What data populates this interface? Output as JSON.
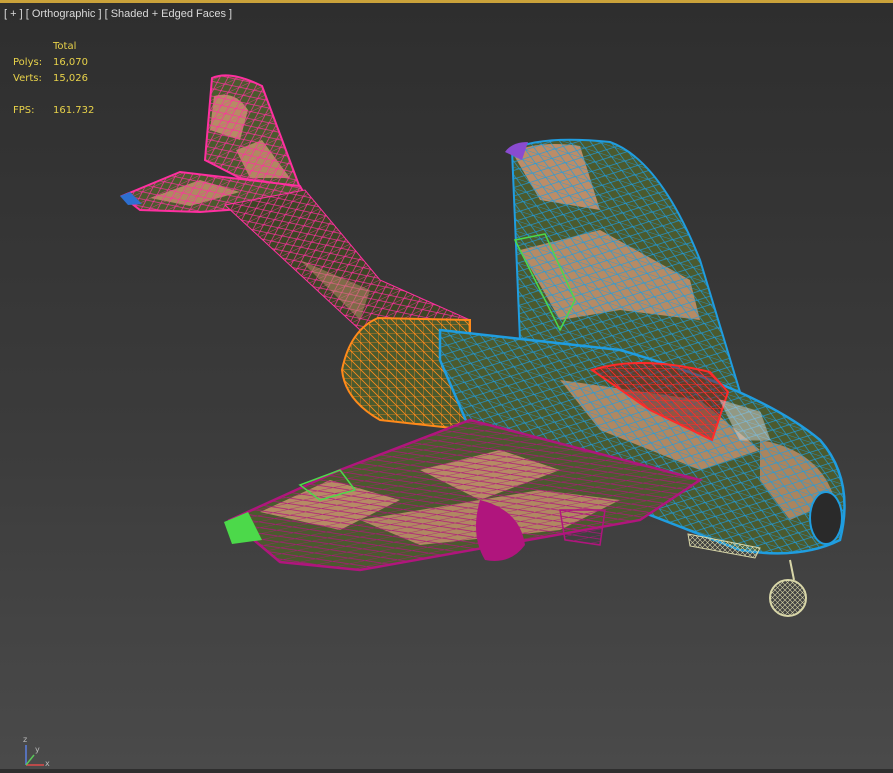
{
  "viewport": {
    "menu_plus": "[ + ]",
    "view_mode": "[ Orthographic ]",
    "shading_mode": "[ Shaded + Edged Faces ]",
    "accent_color": "#caa23a"
  },
  "stats": {
    "header": "Total",
    "polys_label": "Polys:",
    "polys_value": "16,070",
    "verts_label": "Verts:",
    "verts_value": "15,026",
    "fps_label": "FPS:",
    "fps_value": "161.732",
    "text_color": "#e8d24a"
  },
  "model": {
    "colors": {
      "tail": "#ff2fa0",
      "fuselage": "#1f9de0",
      "intake_nacelle": "#ff8a1a",
      "wing_underside": "#b0157d",
      "canopy": "#ff2a2a",
      "wingtip": "#4cd94a",
      "landing_gear": "#d8d6a8",
      "camo_green": "#4b5a2e",
      "camo_tan": "#c2906b"
    }
  },
  "gizmo": {
    "axis_z": "z",
    "axis_y": "y",
    "axis_x": "x"
  }
}
